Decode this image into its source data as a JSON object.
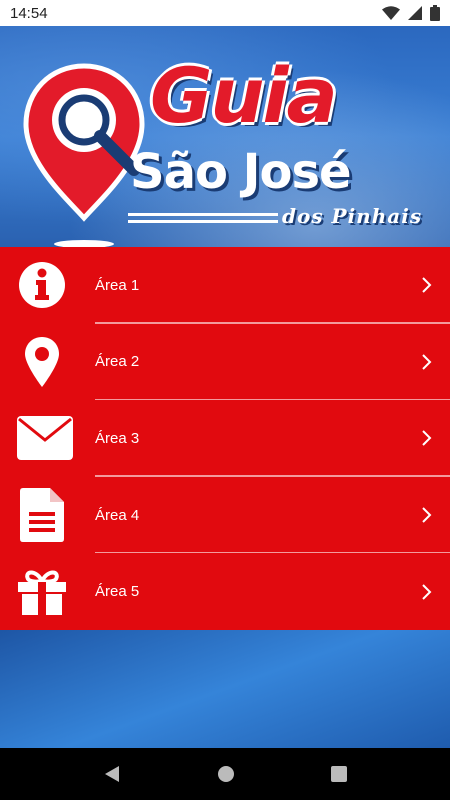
{
  "status_bar": {
    "time": "14:54"
  },
  "banner": {
    "logo_title": "Guia",
    "logo_city": "São José",
    "logo_subtitle": "dos Pinhais"
  },
  "menu": {
    "items": [
      {
        "label": "Área 1",
        "icon": "info-icon"
      },
      {
        "label": "Área 2",
        "icon": "location-pin-icon"
      },
      {
        "label": "Área 3",
        "icon": "envelope-icon"
      },
      {
        "label": "Área 4",
        "icon": "document-icon"
      },
      {
        "label": "Área 5",
        "icon": "gift-icon"
      }
    ]
  },
  "colors": {
    "menu_red": "#e10a0f",
    "brand_blue": "#2b68bf",
    "logo_red": "#e31b2a"
  }
}
